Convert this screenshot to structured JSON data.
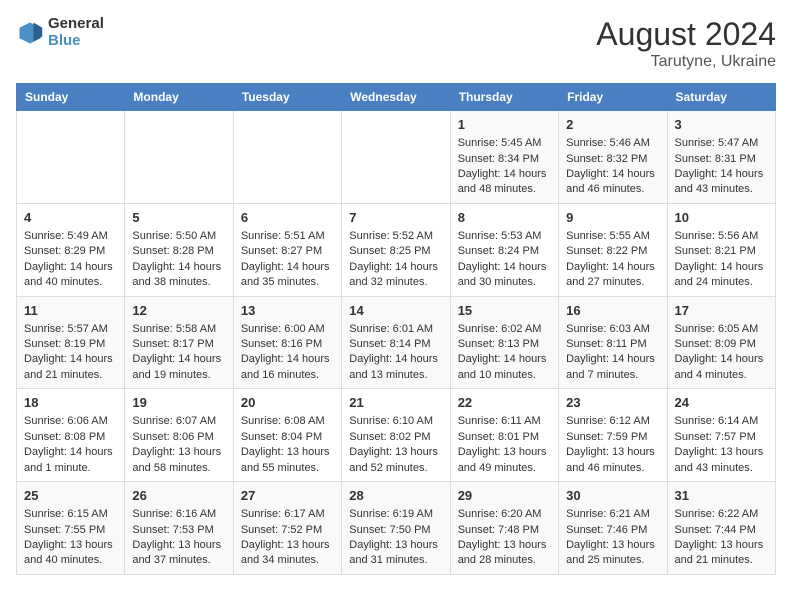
{
  "logo": {
    "line1": "General",
    "line2": "Blue"
  },
  "title": "August 2024",
  "subtitle": "Tarutyne, Ukraine",
  "weekdays": [
    "Sunday",
    "Monday",
    "Tuesday",
    "Wednesday",
    "Thursday",
    "Friday",
    "Saturday"
  ],
  "weeks": [
    [
      {
        "day": "",
        "info": ""
      },
      {
        "day": "",
        "info": ""
      },
      {
        "day": "",
        "info": ""
      },
      {
        "day": "",
        "info": ""
      },
      {
        "day": "1",
        "info": "Sunrise: 5:45 AM\nSunset: 8:34 PM\nDaylight: 14 hours and 48 minutes."
      },
      {
        "day": "2",
        "info": "Sunrise: 5:46 AM\nSunset: 8:32 PM\nDaylight: 14 hours and 46 minutes."
      },
      {
        "day": "3",
        "info": "Sunrise: 5:47 AM\nSunset: 8:31 PM\nDaylight: 14 hours and 43 minutes."
      }
    ],
    [
      {
        "day": "4",
        "info": "Sunrise: 5:49 AM\nSunset: 8:29 PM\nDaylight: 14 hours and 40 minutes."
      },
      {
        "day": "5",
        "info": "Sunrise: 5:50 AM\nSunset: 8:28 PM\nDaylight: 14 hours and 38 minutes."
      },
      {
        "day": "6",
        "info": "Sunrise: 5:51 AM\nSunset: 8:27 PM\nDaylight: 14 hours and 35 minutes."
      },
      {
        "day": "7",
        "info": "Sunrise: 5:52 AM\nSunset: 8:25 PM\nDaylight: 14 hours and 32 minutes."
      },
      {
        "day": "8",
        "info": "Sunrise: 5:53 AM\nSunset: 8:24 PM\nDaylight: 14 hours and 30 minutes."
      },
      {
        "day": "9",
        "info": "Sunrise: 5:55 AM\nSunset: 8:22 PM\nDaylight: 14 hours and 27 minutes."
      },
      {
        "day": "10",
        "info": "Sunrise: 5:56 AM\nSunset: 8:21 PM\nDaylight: 14 hours and 24 minutes."
      }
    ],
    [
      {
        "day": "11",
        "info": "Sunrise: 5:57 AM\nSunset: 8:19 PM\nDaylight: 14 hours and 21 minutes."
      },
      {
        "day": "12",
        "info": "Sunrise: 5:58 AM\nSunset: 8:17 PM\nDaylight: 14 hours and 19 minutes."
      },
      {
        "day": "13",
        "info": "Sunrise: 6:00 AM\nSunset: 8:16 PM\nDaylight: 14 hours and 16 minutes."
      },
      {
        "day": "14",
        "info": "Sunrise: 6:01 AM\nSunset: 8:14 PM\nDaylight: 14 hours and 13 minutes."
      },
      {
        "day": "15",
        "info": "Sunrise: 6:02 AM\nSunset: 8:13 PM\nDaylight: 14 hours and 10 minutes."
      },
      {
        "day": "16",
        "info": "Sunrise: 6:03 AM\nSunset: 8:11 PM\nDaylight: 14 hours and 7 minutes."
      },
      {
        "day": "17",
        "info": "Sunrise: 6:05 AM\nSunset: 8:09 PM\nDaylight: 14 hours and 4 minutes."
      }
    ],
    [
      {
        "day": "18",
        "info": "Sunrise: 6:06 AM\nSunset: 8:08 PM\nDaylight: 14 hours and 1 minute."
      },
      {
        "day": "19",
        "info": "Sunrise: 6:07 AM\nSunset: 8:06 PM\nDaylight: 13 hours and 58 minutes."
      },
      {
        "day": "20",
        "info": "Sunrise: 6:08 AM\nSunset: 8:04 PM\nDaylight: 13 hours and 55 minutes."
      },
      {
        "day": "21",
        "info": "Sunrise: 6:10 AM\nSunset: 8:02 PM\nDaylight: 13 hours and 52 minutes."
      },
      {
        "day": "22",
        "info": "Sunrise: 6:11 AM\nSunset: 8:01 PM\nDaylight: 13 hours and 49 minutes."
      },
      {
        "day": "23",
        "info": "Sunrise: 6:12 AM\nSunset: 7:59 PM\nDaylight: 13 hours and 46 minutes."
      },
      {
        "day": "24",
        "info": "Sunrise: 6:14 AM\nSunset: 7:57 PM\nDaylight: 13 hours and 43 minutes."
      }
    ],
    [
      {
        "day": "25",
        "info": "Sunrise: 6:15 AM\nSunset: 7:55 PM\nDaylight: 13 hours and 40 minutes."
      },
      {
        "day": "26",
        "info": "Sunrise: 6:16 AM\nSunset: 7:53 PM\nDaylight: 13 hours and 37 minutes."
      },
      {
        "day": "27",
        "info": "Sunrise: 6:17 AM\nSunset: 7:52 PM\nDaylight: 13 hours and 34 minutes."
      },
      {
        "day": "28",
        "info": "Sunrise: 6:19 AM\nSunset: 7:50 PM\nDaylight: 13 hours and 31 minutes."
      },
      {
        "day": "29",
        "info": "Sunrise: 6:20 AM\nSunset: 7:48 PM\nDaylight: 13 hours and 28 minutes."
      },
      {
        "day": "30",
        "info": "Sunrise: 6:21 AM\nSunset: 7:46 PM\nDaylight: 13 hours and 25 minutes."
      },
      {
        "day": "31",
        "info": "Sunrise: 6:22 AM\nSunset: 7:44 PM\nDaylight: 13 hours and 21 minutes."
      }
    ]
  ]
}
